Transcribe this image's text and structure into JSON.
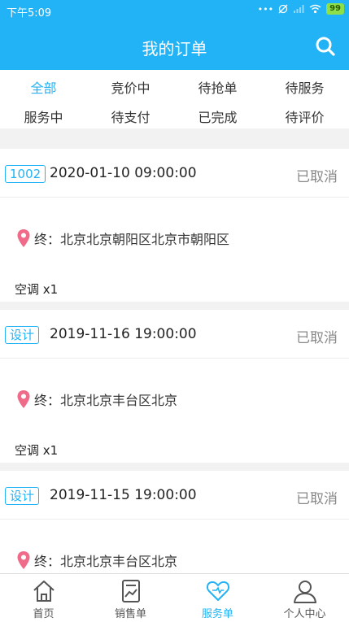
{
  "status_bar": {
    "time": "下午5:09",
    "battery": "99"
  },
  "header": {
    "title": "我的订单",
    "search_icon": "search-icon"
  },
  "tabs": [
    {
      "label": "全部",
      "active": true
    },
    {
      "label": "竞价中"
    },
    {
      "label": "待抢单"
    },
    {
      "label": "待服务"
    },
    {
      "label": "服务中"
    },
    {
      "label": "待支付"
    },
    {
      "label": "已完成"
    },
    {
      "label": "待评价"
    }
  ],
  "orders": [
    {
      "tag": "1002",
      "datetime": "2020-01-10 09:00:00",
      "status": "已取消",
      "destination": "终：北京北京朝阳区北京市朝阳区",
      "item": "空调 x1"
    },
    {
      "tag": "设计",
      "datetime": "2019-11-16 19:00:00",
      "status": "已取消",
      "destination": "终：北京北京丰台区北京",
      "item": "空调 x1"
    },
    {
      "tag": "设计",
      "datetime": "2019-11-15 19:00:00",
      "status": "已取消",
      "destination": "终：北京北京丰台区北京",
      "item": ""
    }
  ],
  "nav": [
    {
      "label": "首页",
      "icon": "home-icon"
    },
    {
      "label": "销售单",
      "icon": "sales-chart-icon"
    },
    {
      "label": "服务单",
      "icon": "heart-icon",
      "active": true
    },
    {
      "label": "个人中心",
      "icon": "user-icon"
    }
  ],
  "colors": {
    "accent": "#21b3f5",
    "pin": "#f06b8a",
    "status": "#888888"
  }
}
